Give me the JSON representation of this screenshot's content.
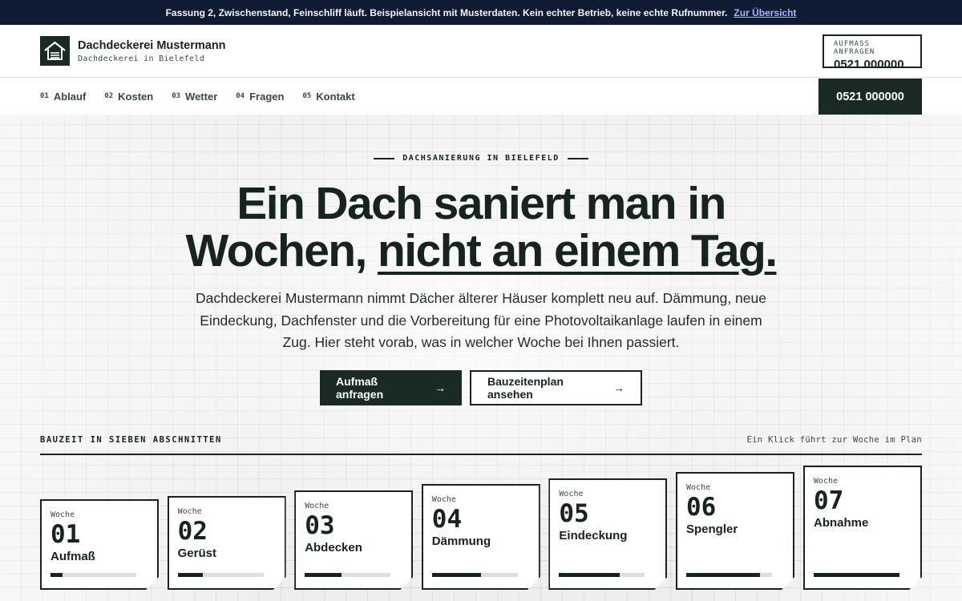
{
  "banner": {
    "text": "Fassung 2, Zwischenstand, Feinschliff läuft. Beispielansicht mit Musterdaten. Kein echter Betrieb, keine echte Rufnummer.",
    "link": "Zur Übersicht"
  },
  "brand": {
    "name": "Dachdeckerei Mustermann",
    "subtitle": "Dachdeckerei in Bielefeld",
    "logo_icon": "house-icon"
  },
  "header_cta": {
    "label": "AUFMASS ANFRAGEN",
    "phone": "0521 000000"
  },
  "nav": {
    "items": [
      {
        "num": "01",
        "label": "Ablauf"
      },
      {
        "num": "02",
        "label": "Kosten"
      },
      {
        "num": "03",
        "label": "Wetter"
      },
      {
        "num": "04",
        "label": "Fragen"
      },
      {
        "num": "05",
        "label": "Kontakt"
      }
    ],
    "phone": "0521 000000"
  },
  "hero": {
    "eyebrow": "DACHSANIERUNG IN BIELEFELD",
    "headline_line1": "Ein Dach saniert man in",
    "headline_line2_a": "Wochen,",
    "headline_line2_b": "nicht an einem Tag.",
    "lead": "Dachdeckerei Mustermann nimmt Dächer älterer Häuser komplett neu auf. Dämmung, neue Eindeckung, Dachfenster und die Vorbereitung für eine Photovoltaikanlage laufen in einem Zug. Hier steht vorab, was in welcher Woche bei Ihnen passiert.",
    "primary_button": "Aufmaß anfragen",
    "secondary_button": "Bauzeitenplan ansehen",
    "arrow": "→"
  },
  "timeline": {
    "title": "BAUZEIT IN SIEBEN ABSCHNITTEN",
    "hint": "Ein Klick führt zur Woche im Plan",
    "week_label": "Woche",
    "weeks": [
      {
        "num": "01",
        "title": "Aufmaß",
        "progress": 0.14
      },
      {
        "num": "02",
        "title": "Gerüst",
        "progress": 0.29
      },
      {
        "num": "03",
        "title": "Abdecken",
        "progress": 0.43
      },
      {
        "num": "04",
        "title": "Dämmung",
        "progress": 0.57
      },
      {
        "num": "05",
        "title": "Eindeckung",
        "progress": 0.71
      },
      {
        "num": "06",
        "title": "Spengler",
        "progress": 0.86
      },
      {
        "num": "07",
        "title": "Abnahme",
        "progress": 1.0
      }
    ]
  },
  "colors": {
    "dark_green": "#1a2b24",
    "banner_navy": "#0f1a33",
    "link_lavender": "#a9b6ff"
  }
}
